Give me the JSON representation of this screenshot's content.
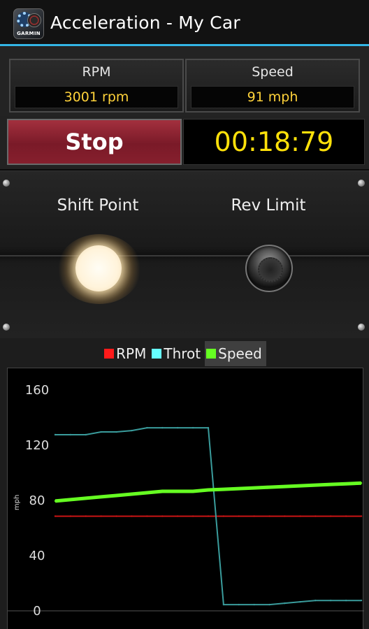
{
  "actionbar": {
    "title": "Acceleration - My Car",
    "icon": "garmin-app-icon",
    "brand": "GARMIN"
  },
  "gauges": {
    "rpm": {
      "label": "RPM",
      "value": "3001 rpm"
    },
    "speed": {
      "label": "Speed",
      "value": "91 mph"
    }
  },
  "controls": {
    "stop_label": "Stop",
    "timer": "00:18:79"
  },
  "lights": {
    "shift_label": "Shift Point",
    "rev_label": "Rev Limit"
  },
  "colors": {
    "rpm": "#ff1a1a",
    "throt": "#66ffff",
    "speed": "#66ff22",
    "value_text": "#ffd23a",
    "timer": "#ffe10a",
    "accent": "#33b5e5",
    "stop": "#8b2230"
  },
  "legend": [
    {
      "label": "RPM",
      "color": "#ff1a1a",
      "active": false
    },
    {
      "label": "Throt",
      "color": "#66ffff",
      "active": false
    },
    {
      "label": "Speed",
      "color": "#66ff22",
      "active": true
    }
  ],
  "chart_data": {
    "type": "line",
    "ylabel": "mph",
    "ylim": [
      0,
      170
    ],
    "yticks": [
      "0",
      "40",
      "80",
      "120",
      "160"
    ],
    "grid": false,
    "x": [
      0,
      1,
      2,
      3,
      4,
      5,
      6,
      7,
      8,
      9,
      10,
      11,
      12,
      13,
      14,
      15,
      16,
      17,
      18,
      19,
      20
    ],
    "series": [
      {
        "name": "RPM",
        "color": "#c81414",
        "values": [
          68,
          68,
          68,
          68,
          68,
          68,
          68,
          68,
          68,
          68,
          68,
          68,
          68,
          68,
          68,
          68,
          68,
          68,
          68,
          68,
          68
        ]
      },
      {
        "name": "Throt",
        "color": "#3a9c9c",
        "values": [
          127,
          127,
          127,
          129,
          129,
          130,
          132,
          132,
          132,
          132,
          132,
          4,
          4,
          4,
          4,
          5,
          6,
          7,
          7,
          7,
          7
        ]
      },
      {
        "name": "Speed",
        "color": "#66ff22",
        "values": [
          79,
          80,
          81,
          82,
          83,
          84,
          85,
          86,
          86,
          86,
          87,
          87.5,
          88,
          88.5,
          89,
          89.5,
          90,
          90.5,
          91,
          91.5,
          92
        ]
      }
    ]
  }
}
